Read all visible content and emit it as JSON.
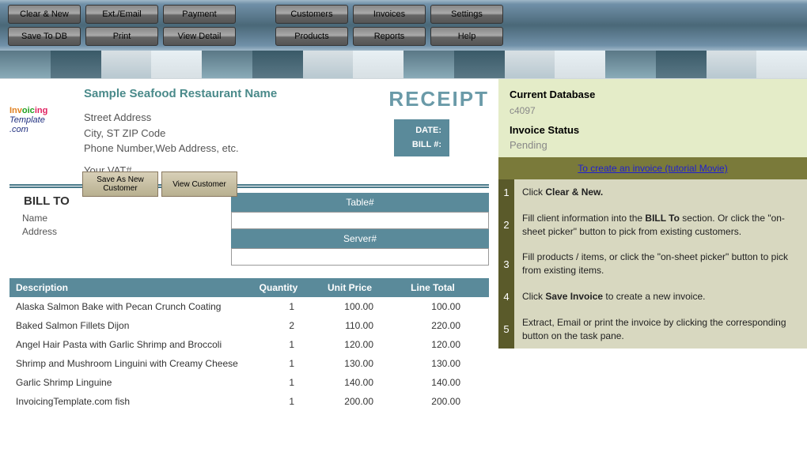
{
  "toolbar": {
    "row1": [
      "Clear & New",
      "Ext./Email",
      "Payment",
      "Customers",
      "Invoices",
      "Settings"
    ],
    "row2": [
      "Save To DB",
      "Print",
      "View Detail",
      "Products",
      "Reports",
      "Help"
    ]
  },
  "business": {
    "name": "Sample Seafood Restaurant Name",
    "street": "Street Address",
    "citystate": "City, ST  ZIP Code",
    "contact": "Phone Number,Web Address, etc.",
    "vat": "Your VAT#"
  },
  "receipt": {
    "title": "RECEIPT",
    "date_label": "DATE:",
    "bill_label": "BILL #:"
  },
  "sheet_buttons": {
    "save_customer": "Save As New Customer",
    "view_customer": "View Customer"
  },
  "billto": {
    "title": "BILL TO",
    "name_label": "Name",
    "address_label": "Address"
  },
  "table_server": {
    "table_label": "Table#",
    "server_label": "Server#"
  },
  "columns": {
    "description": "Description",
    "quantity": "Quantity",
    "unit_price": "Unit Price",
    "line_total": "Line Total"
  },
  "items": [
    {
      "desc": "Alaska Salmon Bake with Pecan Crunch Coating",
      "qty": "1",
      "price": "100.00",
      "total": "100.00"
    },
    {
      "desc": "Baked Salmon Fillets Dijon",
      "qty": "2",
      "price": "110.00",
      "total": "220.00"
    },
    {
      "desc": "Angel Hair Pasta with Garlic Shrimp and Broccoli",
      "qty": "1",
      "price": "120.00",
      "total": "120.00"
    },
    {
      "desc": "Shrimp and Mushroom Linguini with Creamy Cheese",
      "qty": "1",
      "price": "130.00",
      "total": "130.00"
    },
    {
      "desc": "Garlic Shrimp Linguine",
      "qty": "1",
      "price": "140.00",
      "total": "140.00"
    },
    {
      "desc": "InvoicingTemplate.com fish",
      "qty": "1",
      "price": "200.00",
      "total": "200.00"
    }
  ],
  "sidebar": {
    "db_label": "Current Database",
    "db_value": "c4097",
    "status_label": "Invoice Status",
    "status_value": "Pending",
    "tutorial_link": "To create an invoice (tutorial Movie)",
    "steps": [
      {
        "num": "1",
        "html": "Click <b>Clear & New.</b>"
      },
      {
        "num": "2",
        "html": "Fill client information into the <b>BILL To</b> section. Or click the \"on-sheet picker\" button to pick from existing customers."
      },
      {
        "num": "3",
        "html": "Fill products / items, or click the \"on-sheet picker\" button to pick from existing items."
      },
      {
        "num": "4",
        "html": "Click <b>Save Invoice</b> to create a new invoice."
      },
      {
        "num": "5",
        "html": "Extract, Email or print the invoice by clicking the corresponding button on the task pane."
      }
    ]
  },
  "logo": {
    "part1": "Inv",
    "part2": "oic",
    "part3": "ing",
    "part4": "Template",
    "part5": ".com"
  }
}
